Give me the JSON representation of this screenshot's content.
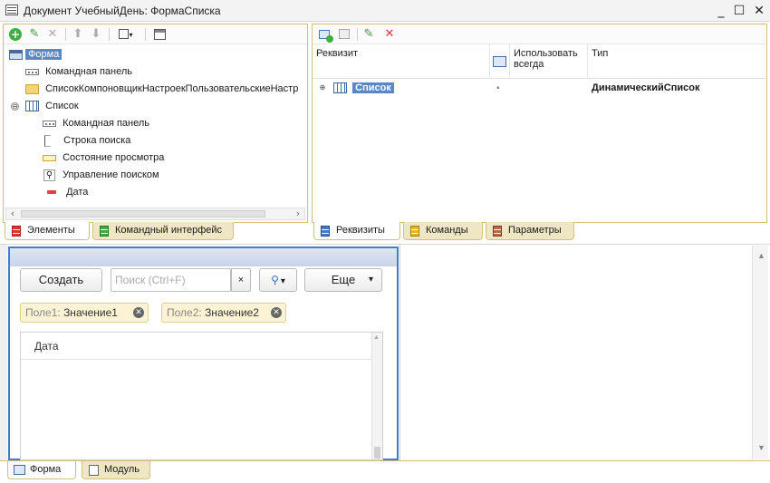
{
  "window": {
    "title": "Документ УчебныйДень: ФормаСписка",
    "minimize": "_",
    "maximize": "☐",
    "close": "✕"
  },
  "left_panel": {
    "toolbar_icons": [
      "add-icon",
      "edit-icon",
      "delete-icon",
      "move-up-icon",
      "move-down-icon",
      "view-menu-icon",
      "form-preview-icon"
    ],
    "tree": [
      {
        "label": "Форма",
        "icon": "form-icon",
        "selected": true
      },
      {
        "label": "Командная панель",
        "icon": "command-bar-icon"
      },
      {
        "label": "СписокКомпоновщикНастроекПользовательскиеНастр",
        "icon": "folder-icon"
      },
      {
        "label": "Список",
        "icon": "table-icon",
        "expander": "⊖"
      },
      {
        "label": "Командная панель",
        "icon": "command-bar-icon"
      },
      {
        "label": "Строка поиска",
        "icon": "input-field-icon"
      },
      {
        "label": "Состояние просмотра",
        "icon": "view-state-icon"
      },
      {
        "label": "Управление поиском",
        "icon": "search-icon"
      },
      {
        "label": "Дата",
        "icon": "date-field-icon"
      }
    ],
    "tabs": [
      {
        "label": "Элементы",
        "active": true
      },
      {
        "label": "Командный интерфейс",
        "active": false
      }
    ]
  },
  "right_panel": {
    "toolbar_icons": [
      "add-attribute-icon",
      "add-column-icon",
      "edit-icon",
      "delete-icon"
    ],
    "columns": {
      "attribute": "Реквизит",
      "use_always": "Использовать всегда",
      "type": "Тип"
    },
    "rows": [
      {
        "expander": "⊕",
        "name": "Список",
        "use_always": "▪",
        "type": "ДинамическийСписок"
      }
    ],
    "tabs": [
      {
        "label": "Реквизиты",
        "active": true
      },
      {
        "label": "Команды",
        "active": false
      },
      {
        "label": "Параметры",
        "active": false
      }
    ]
  },
  "preview": {
    "create_button": "Создать",
    "search_placeholder": "Поиск (Ctrl+F)",
    "search_clear": "×",
    "search_icon": "🔍",
    "search_dropdown": "▾",
    "more_button": "Еще",
    "more_dropdown": "▾",
    "filters": [
      {
        "field": "Поле1:",
        "value": "Значение1"
      },
      {
        "field": "Поле2:",
        "value": "Значение2"
      }
    ],
    "grid_column": "Дата",
    "scroll_up": "▲",
    "scroll_down": "▼"
  },
  "bottom_tabs": [
    {
      "label": "Форма",
      "active": true
    },
    {
      "label": "Модуль",
      "active": false
    }
  ]
}
